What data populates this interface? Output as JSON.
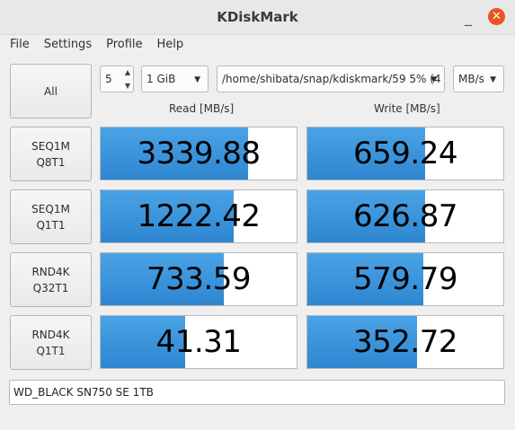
{
  "window": {
    "title": "KDiskMark",
    "minimize_glyph": "_",
    "close_glyph": "✕"
  },
  "menu": [
    "File",
    "Settings",
    "Profile",
    "Help"
  ],
  "controls": {
    "all_button": "All",
    "loops": "5",
    "size": "1 GiB",
    "path": "/home/shibata/snap/kdiskmark/59 5% (4",
    "unit": "MB/s"
  },
  "headers": {
    "read": "Read [MB/s]",
    "write": "Write [MB/s]"
  },
  "tests": [
    {
      "line1": "SEQ1M",
      "line2": "Q8T1",
      "read": "3339.88",
      "write": "659.24",
      "read_fill": 0.75,
      "write_fill": 0.6
    },
    {
      "line1": "SEQ1M",
      "line2": "Q1T1",
      "read": "1222.42",
      "write": "626.87",
      "read_fill": 0.68,
      "write_fill": 0.6
    },
    {
      "line1": "RND4K",
      "line2": "Q32T1",
      "read": "733.59",
      "write": "579.79",
      "read_fill": 0.63,
      "write_fill": 0.59
    },
    {
      "line1": "RND4K",
      "line2": "Q1T1",
      "read": "41.31",
      "write": "352.72",
      "read_fill": 0.43,
      "write_fill": 0.56
    }
  ],
  "device": "WD_BLACK SN750 SE 1TB",
  "colors": {
    "bar": "#2e86d0",
    "close": "#e95420"
  }
}
